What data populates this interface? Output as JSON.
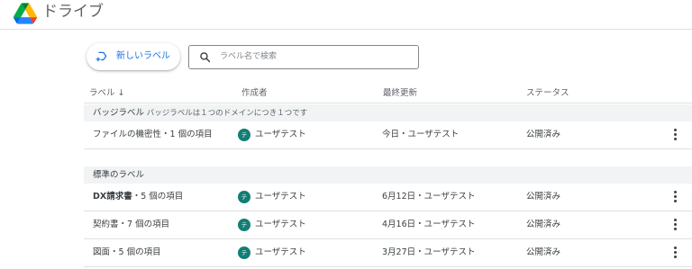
{
  "app": {
    "title": "ドライブ"
  },
  "toolbar": {
    "new_label_button": "新しいラベル",
    "search_placeholder": "ラベル名で検索"
  },
  "columns": {
    "label": "ラベル ↓",
    "creator": "作成者",
    "last_updated": "最終更新",
    "status": "ステータス"
  },
  "sections": [
    {
      "title": "バッジラベル",
      "subtitle": "バッジラベルは１つのドメインにつき１つです",
      "rows": [
        {
          "name": "ファイルの機密性",
          "count": "・1 個の項目",
          "avatar": "テ",
          "creator": "ユーザテスト",
          "updated": "今日・ユーザテスト",
          "status": "公開済み"
        }
      ]
    },
    {
      "title": "標準のラベル",
      "subtitle": "",
      "rows": [
        {
          "name": "DX請求書",
          "count": "・5 個の項目",
          "avatar": "テ",
          "creator": "ユーザテスト",
          "updated": "6月12日・ユーザテスト",
          "status": "公開済み"
        },
        {
          "name": "契約書",
          "count": "・7 個の項目",
          "avatar": "テ",
          "creator": "ユーザテスト",
          "updated": "4月16日・ユーザテスト",
          "status": "公開済み"
        },
        {
          "name": "図面",
          "count": "・5 個の項目",
          "avatar": "テ",
          "creator": "ユーザテスト",
          "updated": "3月27日・ユーザテスト",
          "status": "公開済み"
        }
      ]
    }
  ],
  "colors": {
    "accent": "#1a73e8",
    "avatar": "#137e75",
    "section_bg": "#f1f3f4"
  },
  "icons": {
    "logo": "google-drive-logo",
    "new_label": "new-label-icon",
    "search": "search-icon",
    "more": "more-vert-icon"
  }
}
